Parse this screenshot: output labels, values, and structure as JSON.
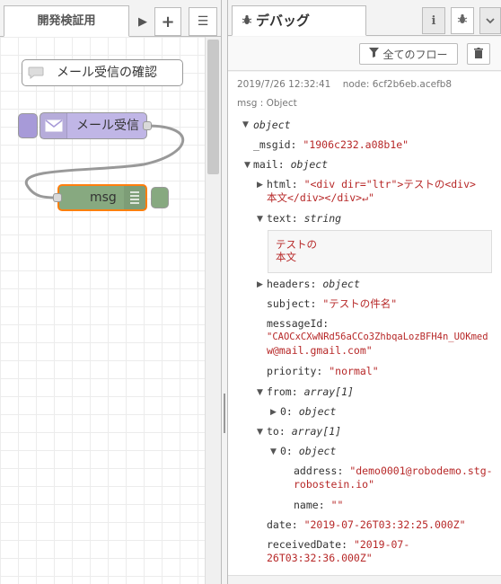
{
  "workspace": {
    "tab_label": "開発検証用",
    "tab_arrow": "▶",
    "add_btn": "+",
    "menu_btn": "☰",
    "nodes": {
      "comment_label": "メール受信の確認",
      "mail_label": "メール受信",
      "debug_label": "msg"
    }
  },
  "sidebar": {
    "tab_label": "デバッグ",
    "info_btn": "i",
    "debug_btn": "🐞",
    "filter_label": "全てのフロー",
    "message": {
      "timestamp": "2019/7/26 12:32:41",
      "node": "node: 6cf2b6eb.acefb8",
      "topic": "msg : Object",
      "root_type": "object",
      "msgid_key": "_msgid:",
      "msgid_val": "\"1906c232.a08b1e\"",
      "mail_key": "mail:",
      "mail_type": "object",
      "html_key": "html:",
      "html_val_1": "\"<div dir=\"ltr\">テストの<div>",
      "html_val_2": "本文</div></div>↵\"",
      "text_key": "text:",
      "text_type": "string",
      "text_line_1": "テストの",
      "text_line_2": "本文",
      "headers_key": "headers:",
      "headers_type": "object",
      "subject_key": "subject:",
      "subject_val": "\"テストの件名\"",
      "messageid_key": "messageId:",
      "messageid_val_1": "\"CAOCxCXwNRd56aCCo3ZhbqaLozBFH4n_UOKmed",
      "messageid_val_2": "w@mail.gmail.com\"",
      "priority_key": "priority:",
      "priority_val": "\"normal\"",
      "from_key": "from:",
      "from_type": "array[1]",
      "from0_key": "0:",
      "from0_type": "object",
      "to_key": "to:",
      "to_type": "array[1]",
      "to0_key": "0:",
      "to0_type": "object",
      "address_key": "address:",
      "address_val_1": "\"demo0001@robodemo.stg-",
      "address_val_2": "robostein.io\"",
      "name_key": "name:",
      "name_val": "\"\"",
      "date_key": "date:",
      "date_val": "\"2019-07-26T03:32:25.000Z\"",
      "received_key": "receivedDate:",
      "received_val_1": "\"2019-07-",
      "received_val_2": "26T03:32:36.000Z\""
    }
  },
  "colors": {
    "mail_node": "#c0b6e6",
    "debug_node": "#87a980",
    "selected_outline": "#ff7f0e",
    "string_value": "#b72828"
  }
}
